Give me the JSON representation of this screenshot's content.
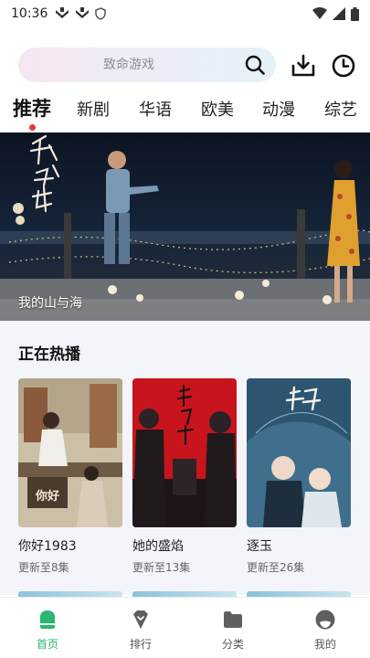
{
  "status_bar": {
    "time": "10:36"
  },
  "search": {
    "placeholder": "致命游戏"
  },
  "tabs": [
    {
      "label": "推荐",
      "active": true
    },
    {
      "label": "新剧"
    },
    {
      "label": "华语"
    },
    {
      "label": "欧美"
    },
    {
      "label": "动漫"
    },
    {
      "label": "综艺"
    }
  ],
  "banner": {
    "caption": "我的山与海",
    "artwork_text": "我的山与海"
  },
  "section": {
    "title": "正在热播",
    "items": [
      {
        "title": "你好1983",
        "subtitle": "更新至8集",
        "poster_text": "你好1983"
      },
      {
        "title": "她的盛焰",
        "subtitle": "更新至13集",
        "poster_text": "她的盛焰"
      },
      {
        "title": "逐玉",
        "subtitle": "更新至26集",
        "poster_text": "逐玉"
      }
    ]
  },
  "bottom_nav": [
    {
      "label": "首页",
      "icon": "home-icon",
      "active": true
    },
    {
      "label": "排行",
      "icon": "ranking-icon"
    },
    {
      "label": "分类",
      "icon": "folder-icon"
    },
    {
      "label": "我的",
      "icon": "profile-icon"
    }
  ],
  "colors": {
    "accent": "#2bb673",
    "tab_dot": "#e53935",
    "section_bg": "#f4f4fb"
  }
}
